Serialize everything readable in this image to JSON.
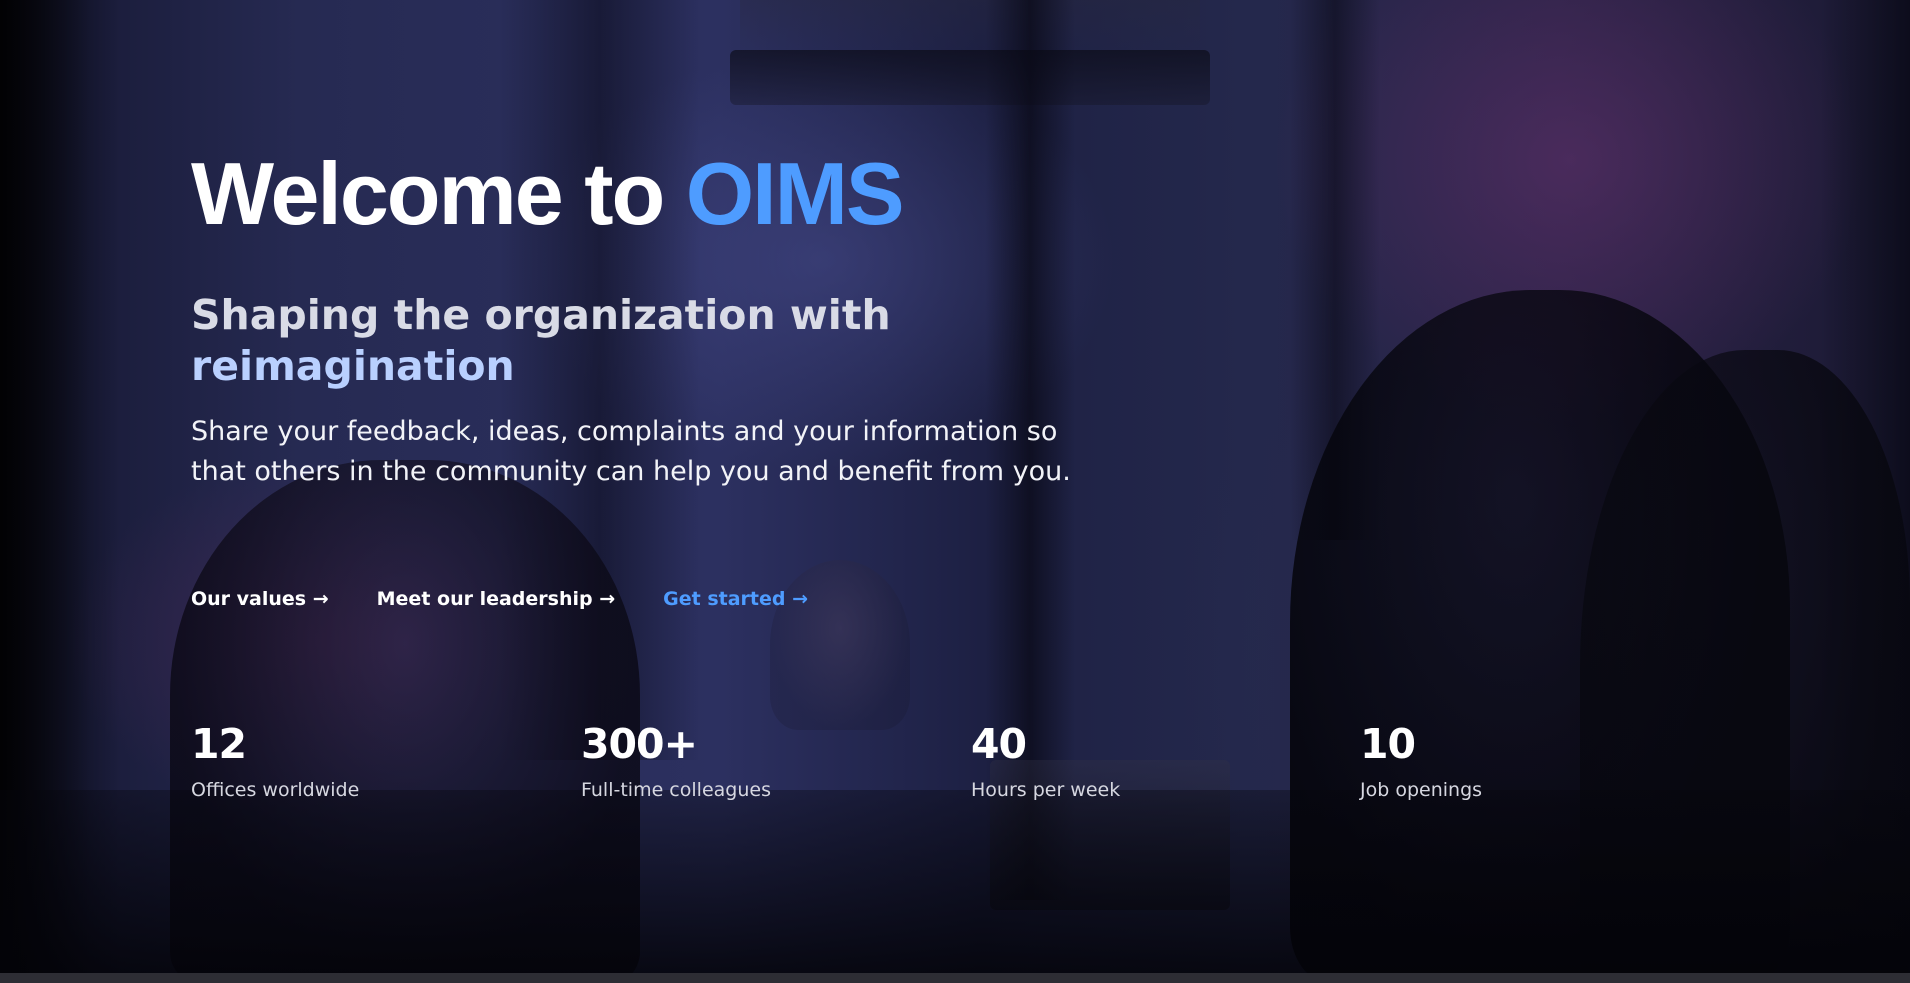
{
  "hero": {
    "title_prefix": "Welcome to ",
    "title_accent": "OIMS",
    "subtitle_prefix": "Shaping the organization with ",
    "subtitle_accent": "reimagination",
    "description": "Share your feedback, ideas, complaints and your information so that others in the community can help you and benefit from you."
  },
  "links": [
    {
      "label": "Our values →"
    },
    {
      "label": "Meet our leadership →"
    },
    {
      "label": "Get started →"
    }
  ],
  "stats": [
    {
      "value": "12",
      "label": "Offices worldwide"
    },
    {
      "value": "300+",
      "label": "Full-time colleagues"
    },
    {
      "value": "40",
      "label": "Hours per week"
    },
    {
      "value": "10",
      "label": "Job openings"
    }
  ],
  "colors": {
    "accent": "#4e9cff",
    "accent_light": "#b9d0ff",
    "background": "#171a34"
  }
}
